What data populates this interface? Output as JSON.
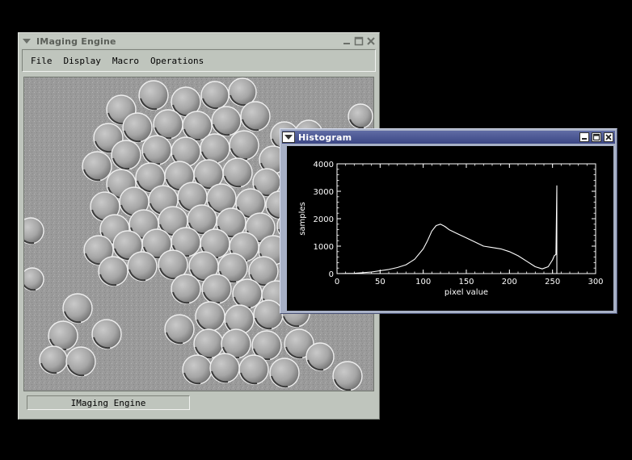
{
  "main_window": {
    "title": "IMaging Engine",
    "menu": [
      "File",
      "Display",
      "Macro",
      "Operations"
    ],
    "status": "IMaging Engine"
  },
  "histogram_window": {
    "title": "Histogram"
  },
  "chart_data": {
    "type": "line",
    "title": "",
    "xlabel": "pixel value",
    "ylabel": "samples",
    "xlim": [
      0,
      300
    ],
    "ylim": [
      0,
      4000
    ],
    "x_ticks": [
      0,
      50,
      100,
      150,
      200,
      250,
      300
    ],
    "y_ticks": [
      0,
      1000,
      2000,
      3000,
      4000
    ],
    "grid": false,
    "series": [
      {
        "x": [
          0,
          20,
          40,
          60,
          70,
          80,
          90,
          100,
          105,
          110,
          115,
          120,
          125,
          130,
          140,
          150,
          160,
          170,
          180,
          190,
          200,
          210,
          220,
          230,
          238,
          245,
          250,
          252,
          254,
          255
        ],
        "y": [
          0,
          10,
          60,
          150,
          220,
          320,
          520,
          900,
          1200,
          1550,
          1750,
          1800,
          1720,
          1600,
          1450,
          1300,
          1150,
          1000,
          950,
          900,
          800,
          650,
          450,
          250,
          170,
          250,
          500,
          650,
          700,
          3200
        ]
      }
    ]
  }
}
